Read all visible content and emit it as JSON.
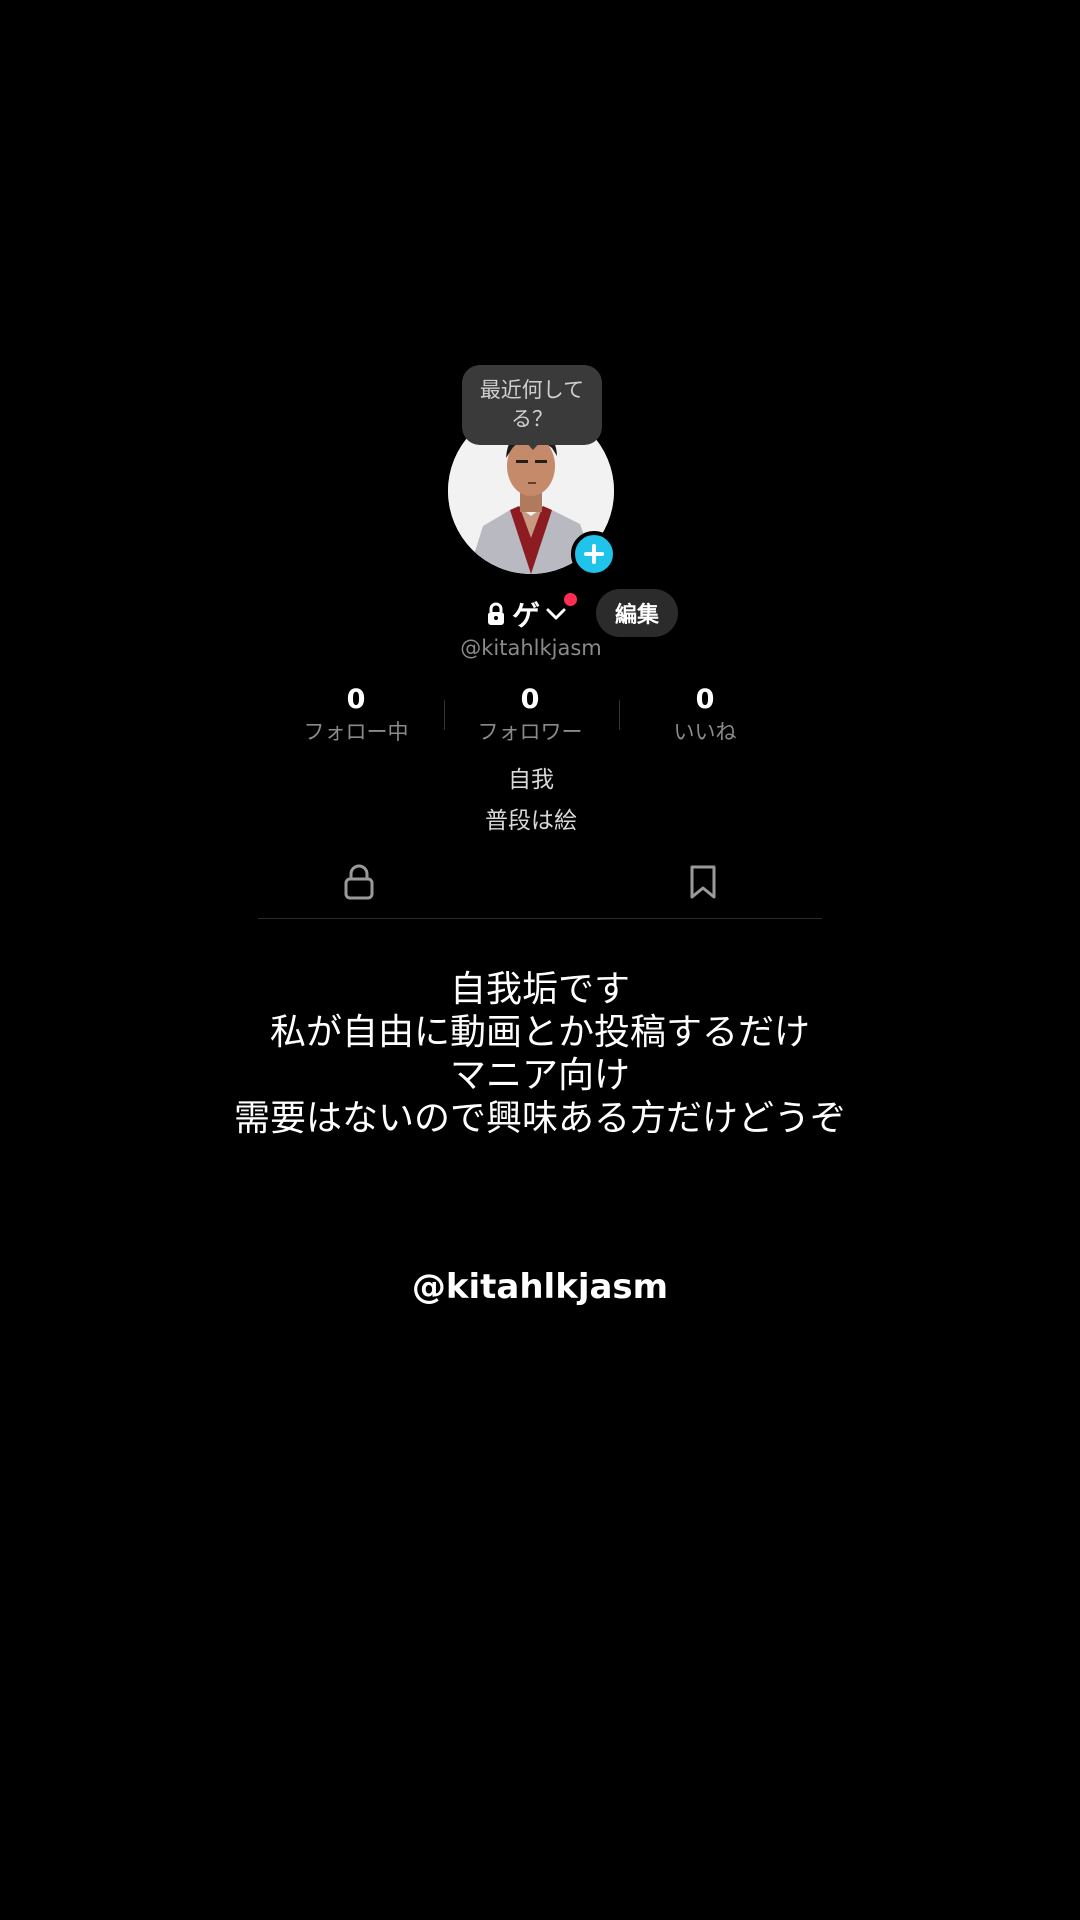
{
  "profile": {
    "bubble_text": "最近何して\nる？",
    "display_name": "ゲ",
    "edit_label": "編集",
    "username": "@kitahlkjasm",
    "stats": [
      {
        "value": "0",
        "label": "フォロー中"
      },
      {
        "value": "0",
        "label": "フォロワー"
      },
      {
        "value": "0",
        "label": "いいね"
      }
    ],
    "bio": [
      "自我",
      "普段は絵"
    ],
    "tabs": [
      "lock-icon",
      "bookmark-icon"
    ],
    "accent_color": "#20c3ea",
    "notification_color": "#ff2d55"
  },
  "overlay": {
    "lines": [
      "自我垢です",
      "私が自由に動画とか投稿するだけ",
      "マニア向け",
      "需要はないので興味ある方だけどうぞ"
    ],
    "handle": "@kitahlkjasm"
  }
}
